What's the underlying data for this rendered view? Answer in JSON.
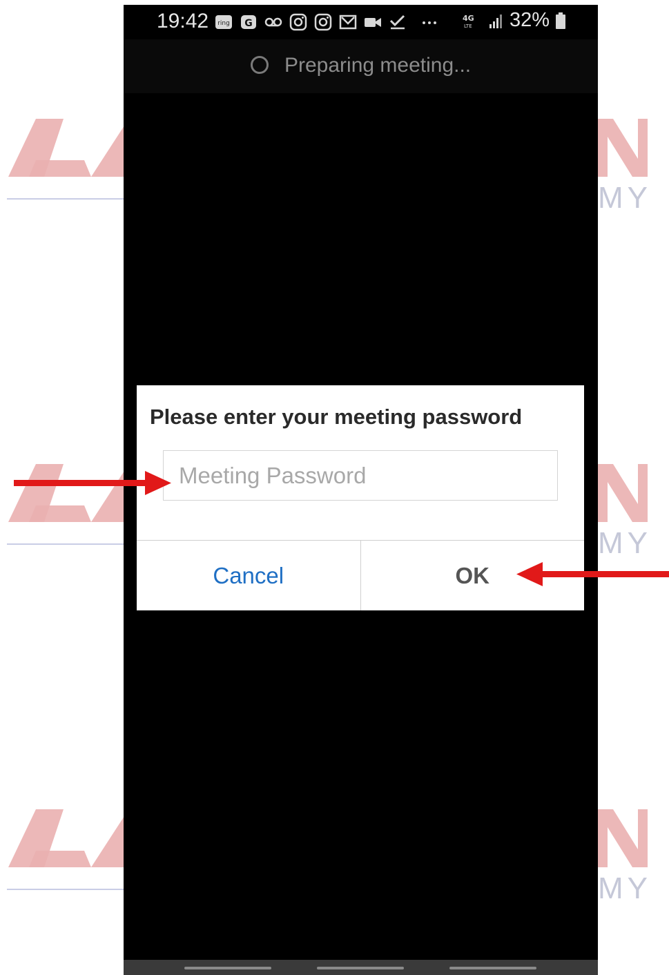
{
  "status_bar": {
    "time": "19:42",
    "icons": [
      "ring-app-icon",
      "g-app-icon",
      "voicemail-icon",
      "instagram-icon",
      "instagram-icon",
      "gmail-icon",
      "video-camera-icon",
      "checkmark-icon",
      "more-dots-icon"
    ],
    "network": "4G LTE",
    "battery": "32%"
  },
  "meeting_status": {
    "text": "Preparing meeting..."
  },
  "dialog": {
    "title": "Please enter your meeting password",
    "password_placeholder": "Meeting Password",
    "password_value": "",
    "cancel_label": "Cancel",
    "ok_label": "OK"
  },
  "annotations": {
    "arrow_color": "#e11919",
    "targets": [
      "password-input",
      "ok-button"
    ]
  },
  "watermark": {
    "text": "MY",
    "color": "#e8a3a3"
  }
}
